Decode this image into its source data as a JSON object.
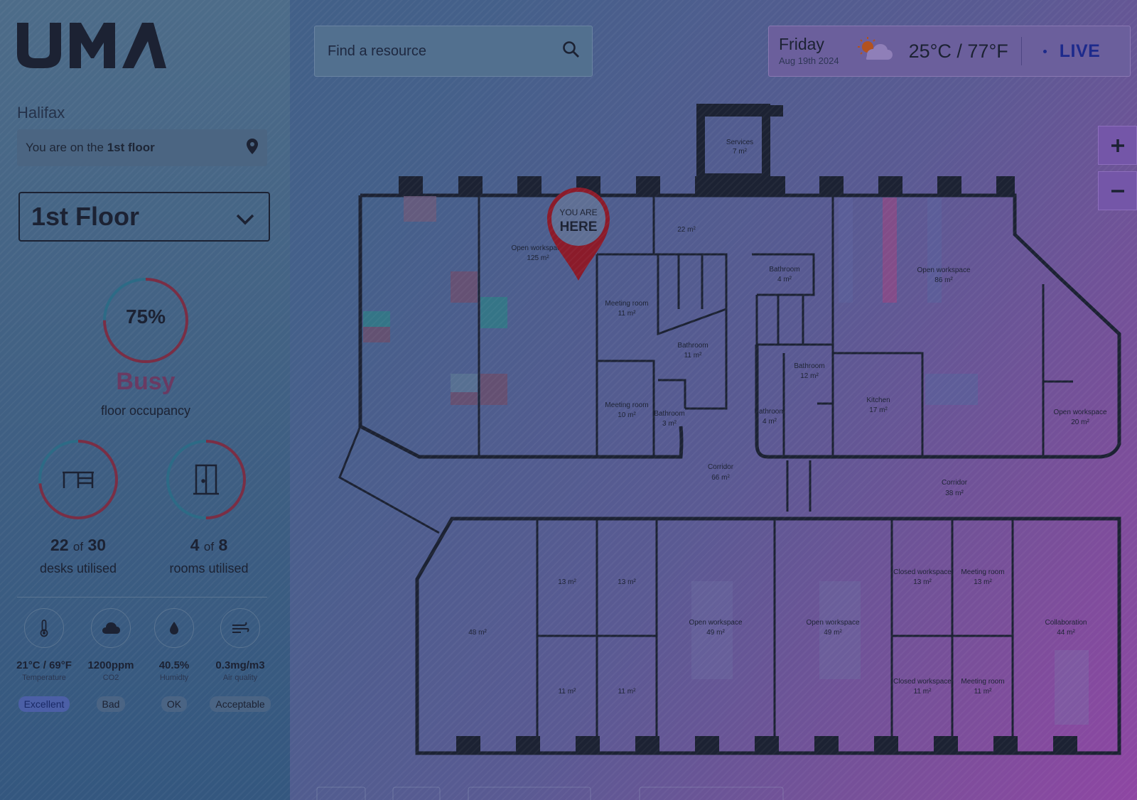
{
  "brand": {
    "logo_text": "UMA"
  },
  "location": {
    "city": "Halifax",
    "floor_note_prefix": "You are on the",
    "floor_note_bold": "1st floor",
    "floor_select": "1st Floor"
  },
  "occupancy": {
    "percent_text": "75%",
    "percent": 75,
    "status": "Busy",
    "caption": "floor occupancy",
    "desks": {
      "used": "22",
      "of": "of",
      "total": "30",
      "label": "desks utilised",
      "fraction": 0.733
    },
    "rooms": {
      "used": "4",
      "of": "of",
      "total": "8",
      "label": "rooms utilised",
      "fraction": 0.5
    }
  },
  "environment": [
    {
      "icon": "thermometer-icon",
      "value": "21°C / 69°F",
      "label": "Temperature",
      "status": "Excellent"
    },
    {
      "icon": "co2-cloud-icon",
      "value": "1200ppm",
      "label": "CO2",
      "status": "Bad"
    },
    {
      "icon": "humidity-drop-icon",
      "value": "40.5%",
      "label": "Humidty",
      "status": "OK"
    },
    {
      "icon": "air-quality-icon",
      "value": "0.3mg/m3",
      "label": "Air quality",
      "status": "Acceptable"
    }
  ],
  "search": {
    "placeholder": "Find a resource"
  },
  "weather": {
    "day": "Friday",
    "date": "Aug 19th 2024",
    "icon": "partly-cloudy-icon",
    "temperature": "25°C / 77°F",
    "live": "LIVE"
  },
  "zoom": {
    "in": "zoom-in-icon",
    "out": "zoom-out-icon"
  },
  "map": {
    "pin": {
      "line1": "YOU ARE",
      "line2": "HERE"
    },
    "rooms": {
      "services": {
        "name": "Services",
        "area": "7 m²"
      },
      "open_ws_a": {
        "name": "Open workspace",
        "area": "125 m²"
      },
      "r22": {
        "area": "22 m²"
      },
      "bathroom_a": {
        "name": "Bathroom",
        "area": "4 m²"
      },
      "open_ws_b": {
        "name": "Open workspace",
        "area": "86 m²"
      },
      "meeting_a": {
        "name": "Meeting room",
        "area": "11 m²"
      },
      "bathroom_b": {
        "name": "Bathroom",
        "area": "11 m²"
      },
      "bathroom_c": {
        "name": "Bathroom",
        "area": "12 m²"
      },
      "kitchen": {
        "name": "Kitchen",
        "area": "17 m²"
      },
      "meeting_b": {
        "name": "Meeting room",
        "area": "10 m²"
      },
      "bathroom_d": {
        "name": "Bathroom",
        "area": "3 m²"
      },
      "bathroom_e": {
        "name": "Bathroom",
        "area": "4 m²"
      },
      "open_ws_c": {
        "name": "Open workspace",
        "area": "20 m²"
      },
      "corridor_a": {
        "name": "Corridor",
        "area": "66 m²"
      },
      "corridor_b": {
        "name": "Corridor",
        "area": "38 m²"
      },
      "r13a": {
        "area": "13 m²"
      },
      "r13b": {
        "area": "13 m²"
      },
      "r48": {
        "area": "48 m²"
      },
      "r11a": {
        "area": "11 m²"
      },
      "r11b": {
        "area": "11 m²"
      },
      "open_ws_d": {
        "name": "Open workspace",
        "area": "49 m²"
      },
      "open_ws_e": {
        "name": "Open workspace",
        "area": "49 m²"
      },
      "closed_ws_a": {
        "name": "Closed workspace",
        "area": "13 m²"
      },
      "meeting_c": {
        "name": "Meeting room",
        "area": "13 m²"
      },
      "collab": {
        "name": "Collaboration",
        "area": "44 m²"
      },
      "closed_ws_b": {
        "name": "Closed workspace",
        "area": "11 m²"
      },
      "meeting_d": {
        "name": "Meeting room",
        "area": "11 m²"
      }
    }
  },
  "colors": {
    "ring_red": "#7a2e45",
    "ring_blue": "#2d6b86",
    "pin_red": "#8b1b2a",
    "live_blue": "#1d2a8c",
    "busy_text": "#6a3a62"
  }
}
